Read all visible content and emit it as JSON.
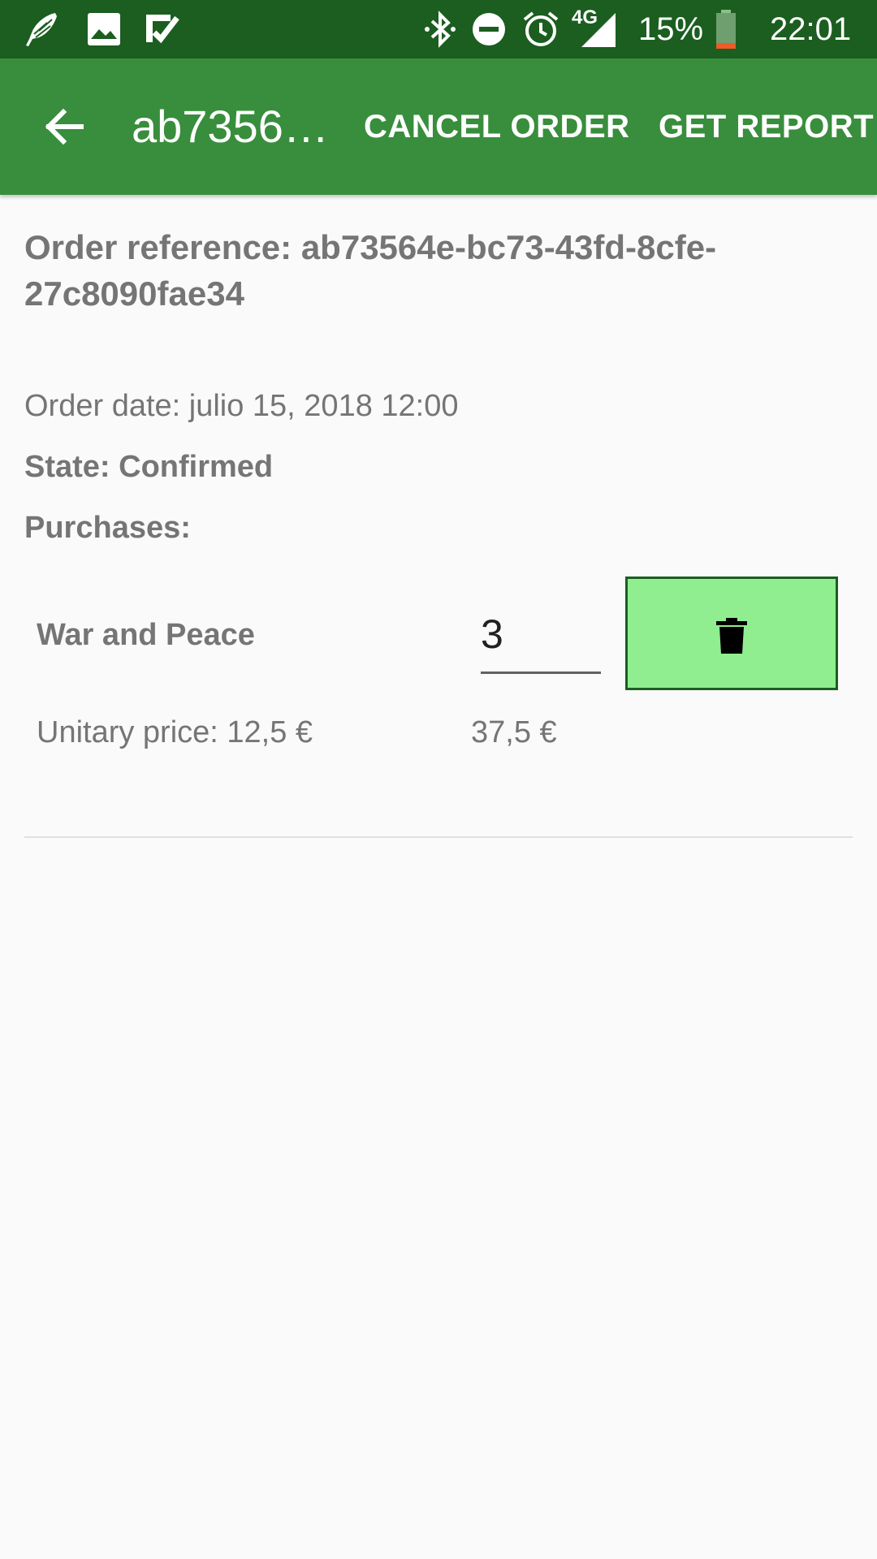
{
  "status_bar": {
    "battery_percent": "15%",
    "time": "22:01",
    "network_type": "4G",
    "left_icons": [
      "launcher-feather-icon",
      "image-icon",
      "check-list-icon"
    ],
    "right_icons": [
      "bluetooth-icon",
      "do-not-disturb-icon",
      "alarm-icon",
      "signal-icon",
      "battery-icon"
    ]
  },
  "app_bar": {
    "title": "ab73564e-bc73-43fd-8cfe-27c8090fae34",
    "cancel_order_label": "CANCEL ORDER",
    "get_report_label": "GET REPORT",
    "back_icon": "arrow-back-icon"
  },
  "order": {
    "reference_text": "Order reference: ab73564e-bc73-43fd-8cfe-27c8090fae34",
    "date_text": "Order date: julio 15, 2018 12:00",
    "state_text": "State: Confirmed",
    "purchases_label": "Purchases:"
  },
  "purchases": [
    {
      "title": "War and Peace",
      "quantity": "3",
      "unit_price_text": "Unitary price: 12,5 €",
      "total_text": "37,5 €",
      "delete_icon": "trash-icon"
    }
  ],
  "colors": {
    "status_bar": "#1b5e20",
    "app_bar": "#388e3c",
    "delete_button": "#90ee90",
    "delete_border": "#1b5e20",
    "text_secondary": "#757575"
  }
}
